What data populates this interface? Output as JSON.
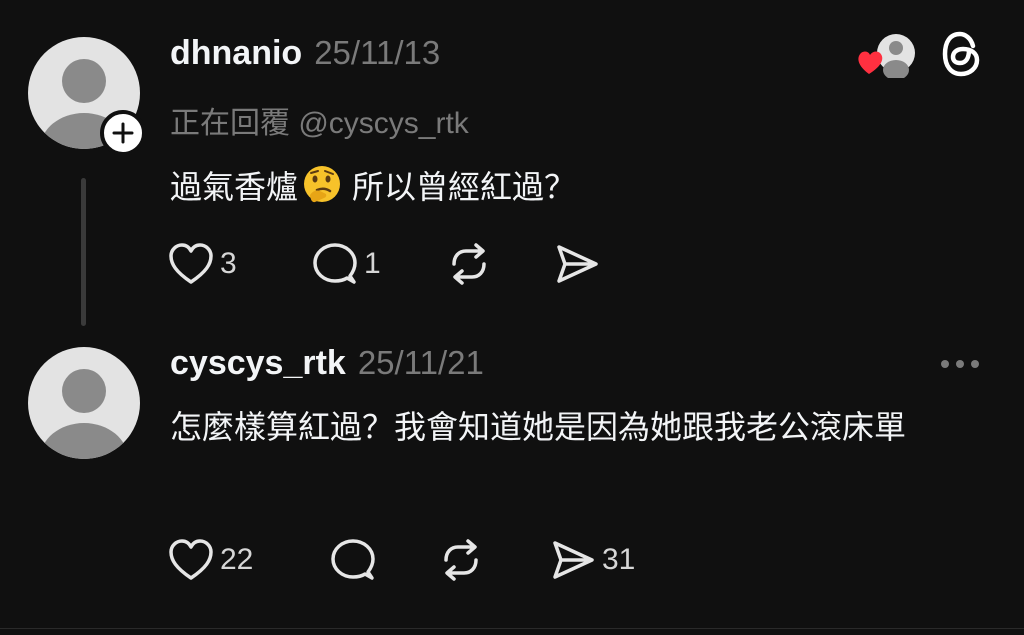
{
  "colors": {
    "background": "#101010",
    "text_primary": "#f3f5f7",
    "text_secondary": "#7a7a7a",
    "like_heart": "#ff3040"
  },
  "post": {
    "username": "dhnanio",
    "timestamp": "25/11/13",
    "reply_to": "正在回覆 @cyscys_rtk",
    "text_before_emoji": "過氣香爐",
    "emoji": "thinking-face-icon",
    "text_after_emoji": "所以曾經紅過？",
    "likes": "3",
    "comments": "1",
    "header_icons": [
      "liked-by-avatar-icon",
      "threads-logo-icon"
    ]
  },
  "reply": {
    "username": "cyscys_rtk",
    "timestamp": "25/11/21",
    "text": "怎麼樣算紅過？我會知道她是因為她跟我老公滾床單",
    "likes": "22",
    "shares": "31",
    "menu_icon": "more-options-icon"
  }
}
